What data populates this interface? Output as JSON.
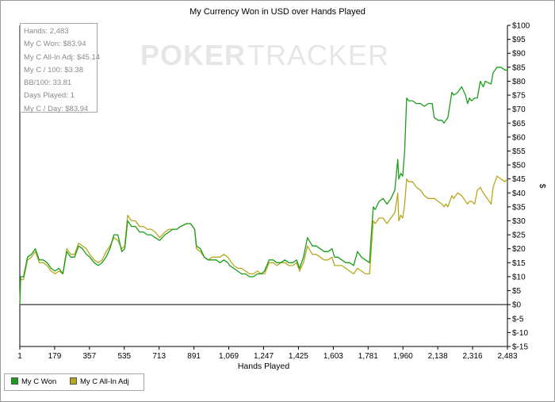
{
  "colors": {
    "won": "#1a9e1a",
    "allin": "#b5a81e",
    "zero_line": "#000000",
    "watermark": "#e6e6e6"
  },
  "watermark": {
    "left": "POKER",
    "right": "TRACKER"
  },
  "stats": [
    "Hands: 2,483",
    "My C Won: $83.94",
    "My C All-In Adj: $45.14",
    "My C / 100: $3.38",
    "BB/100: 33.81",
    "Days Played: 1",
    "My C / Day: $83.94"
  ],
  "legend": [
    {
      "label": "My C Won",
      "color": "#1a9e1a"
    },
    {
      "label": "My C All-In Adj",
      "color": "#b5a81e"
    }
  ],
  "chart_data": {
    "type": "line",
    "title": "My Currency Won in USD over Hands Played",
    "xlabel": "Hands Played",
    "ylabel": "$",
    "xlim": [
      1,
      2483
    ],
    "ylim": [
      -15,
      100
    ],
    "x_ticks": [
      "1",
      "179",
      "357",
      "535",
      "713",
      "891",
      "1,069",
      "1,247",
      "1,425",
      "1,603",
      "1,781",
      "1,960",
      "2,138",
      "2,316",
      "2,483"
    ],
    "y_ticks": [
      -15,
      -10,
      -5,
      0,
      5,
      10,
      15,
      20,
      25,
      30,
      35,
      40,
      45,
      50,
      55,
      60,
      65,
      70,
      75,
      80,
      85,
      90,
      95,
      100
    ],
    "y_tick_labels": [
      "$-15",
      "$-10",
      "$-5",
      "$0",
      "$5",
      "$10",
      "$15",
      "$20",
      "$25",
      "$30",
      "$35",
      "$40",
      "$45",
      "$50",
      "$55",
      "$60",
      "$65",
      "$70",
      "$75",
      "$80",
      "$85",
      "$90",
      "$95",
      "$100"
    ],
    "legend_position": "bottom-left",
    "grid": false,
    "series": [
      {
        "name": "My C Won",
        "color": "#1a9e1a",
        "points": [
          [
            1,
            0
          ],
          [
            5,
            10
          ],
          [
            20,
            10
          ],
          [
            40,
            17
          ],
          [
            60,
            18
          ],
          [
            80,
            20
          ],
          [
            100,
            16
          ],
          [
            120,
            16
          ],
          [
            140,
            15
          ],
          [
            160,
            13
          ],
          [
            180,
            12
          ],
          [
            200,
            13
          ],
          [
            220,
            11
          ],
          [
            240,
            19
          ],
          [
            260,
            17
          ],
          [
            280,
            17
          ],
          [
            300,
            21
          ],
          [
            320,
            20
          ],
          [
            340,
            18
          ],
          [
            357,
            17
          ],
          [
            380,
            15
          ],
          [
            400,
            14
          ],
          [
            420,
            15
          ],
          [
            440,
            17
          ],
          [
            460,
            20
          ],
          [
            480,
            25
          ],
          [
            500,
            25
          ],
          [
            520,
            19
          ],
          [
            535,
            20
          ],
          [
            550,
            30
          ],
          [
            570,
            28
          ],
          [
            590,
            28
          ],
          [
            610,
            26
          ],
          [
            630,
            26
          ],
          [
            650,
            25
          ],
          [
            670,
            25
          ],
          [
            690,
            24
          ],
          [
            713,
            23
          ],
          [
            740,
            25
          ],
          [
            760,
            26
          ],
          [
            780,
            27
          ],
          [
            800,
            27
          ],
          [
            820,
            28
          ],
          [
            850,
            29
          ],
          [
            870,
            29
          ],
          [
            891,
            27
          ],
          [
            900,
            21
          ],
          [
            920,
            20
          ],
          [
            940,
            17
          ],
          [
            960,
            16
          ],
          [
            980,
            16
          ],
          [
            1000,
            16
          ],
          [
            1020,
            15
          ],
          [
            1040,
            16
          ],
          [
            1060,
            15
          ],
          [
            1069,
            14
          ],
          [
            1090,
            13
          ],
          [
            1110,
            12
          ],
          [
            1130,
            11
          ],
          [
            1150,
            11
          ],
          [
            1170,
            10
          ],
          [
            1190,
            10
          ],
          [
            1210,
            11
          ],
          [
            1230,
            11
          ],
          [
            1247,
            12
          ],
          [
            1270,
            16
          ],
          [
            1290,
            16
          ],
          [
            1310,
            15
          ],
          [
            1330,
            15
          ],
          [
            1350,
            16
          ],
          [
            1370,
            15
          ],
          [
            1390,
            15
          ],
          [
            1410,
            16
          ],
          [
            1425,
            13
          ],
          [
            1445,
            17
          ],
          [
            1465,
            24
          ],
          [
            1490,
            21
          ],
          [
            1510,
            21
          ],
          [
            1530,
            20
          ],
          [
            1550,
            19
          ],
          [
            1570,
            19
          ],
          [
            1590,
            20
          ],
          [
            1603,
            17
          ],
          [
            1620,
            17
          ],
          [
            1640,
            16
          ],
          [
            1660,
            15
          ],
          [
            1680,
            15
          ],
          [
            1700,
            14
          ],
          [
            1720,
            19
          ],
          [
            1740,
            17
          ],
          [
            1760,
            16
          ],
          [
            1781,
            15
          ],
          [
            1790,
            25
          ],
          [
            1800,
            35
          ],
          [
            1810,
            34
          ],
          [
            1830,
            37
          ],
          [
            1850,
            38
          ],
          [
            1870,
            36
          ],
          [
            1890,
            38
          ],
          [
            1910,
            41
          ],
          [
            1925,
            52
          ],
          [
            1930,
            45
          ],
          [
            1940,
            47
          ],
          [
            1950,
            46
          ],
          [
            1960,
            55
          ],
          [
            1970,
            74
          ],
          [
            1980,
            73
          ],
          [
            2000,
            73
          ],
          [
            2020,
            72
          ],
          [
            2040,
            72
          ],
          [
            2060,
            71
          ],
          [
            2080,
            72
          ],
          [
            2100,
            72
          ],
          [
            2110,
            67
          ],
          [
            2130,
            66
          ],
          [
            2150,
            66
          ],
          [
            2160,
            65
          ],
          [
            2170,
            66
          ],
          [
            2180,
            67
          ],
          [
            2200,
            76
          ],
          [
            2210,
            75
          ],
          [
            2230,
            76
          ],
          [
            2250,
            78
          ],
          [
            2270,
            75
          ],
          [
            2280,
            72
          ],
          [
            2290,
            74
          ],
          [
            2300,
            73
          ],
          [
            2316,
            74
          ],
          [
            2330,
            74
          ],
          [
            2345,
            80
          ],
          [
            2360,
            78
          ],
          [
            2370,
            80
          ],
          [
            2400,
            79
          ],
          [
            2410,
            83
          ],
          [
            2430,
            85
          ],
          [
            2450,
            85
          ],
          [
            2470,
            84
          ],
          [
            2483,
            84
          ]
        ]
      },
      {
        "name": "My C All-In Adj",
        "color": "#b5a81e",
        "points": [
          [
            1,
            0
          ],
          [
            5,
            9
          ],
          [
            20,
            9
          ],
          [
            40,
            16
          ],
          [
            60,
            17
          ],
          [
            80,
            19
          ],
          [
            100,
            15
          ],
          [
            120,
            15
          ],
          [
            140,
            14
          ],
          [
            160,
            12
          ],
          [
            180,
            11
          ],
          [
            200,
            12
          ],
          [
            220,
            11
          ],
          [
            240,
            20
          ],
          [
            260,
            18
          ],
          [
            280,
            18
          ],
          [
            300,
            22
          ],
          [
            320,
            21
          ],
          [
            340,
            20
          ],
          [
            357,
            18
          ],
          [
            380,
            16
          ],
          [
            400,
            15
          ],
          [
            420,
            16
          ],
          [
            440,
            19
          ],
          [
            460,
            21
          ],
          [
            480,
            24
          ],
          [
            500,
            23
          ],
          [
            520,
            20
          ],
          [
            535,
            21
          ],
          [
            550,
            32
          ],
          [
            570,
            30
          ],
          [
            590,
            30
          ],
          [
            610,
            28
          ],
          [
            630,
            28
          ],
          [
            650,
            27
          ],
          [
            670,
            27
          ],
          [
            690,
            26
          ],
          [
            713,
            24
          ],
          [
            740,
            26
          ],
          [
            760,
            27
          ],
          [
            780,
            27
          ],
          [
            800,
            27
          ],
          [
            820,
            28
          ],
          [
            850,
            29
          ],
          [
            870,
            29
          ],
          [
            891,
            27
          ],
          [
            900,
            20
          ],
          [
            920,
            19
          ],
          [
            940,
            17
          ],
          [
            960,
            16
          ],
          [
            980,
            17
          ],
          [
            1000,
            17
          ],
          [
            1020,
            17
          ],
          [
            1040,
            18
          ],
          [
            1060,
            17
          ],
          [
            1069,
            16
          ],
          [
            1090,
            14
          ],
          [
            1110,
            13
          ],
          [
            1130,
            13
          ],
          [
            1150,
            12
          ],
          [
            1170,
            11
          ],
          [
            1190,
            11
          ],
          [
            1210,
            12
          ],
          [
            1230,
            11
          ],
          [
            1247,
            11
          ],
          [
            1270,
            15
          ],
          [
            1290,
            15
          ],
          [
            1310,
            14
          ],
          [
            1330,
            15
          ],
          [
            1350,
            15
          ],
          [
            1370,
            14
          ],
          [
            1390,
            14
          ],
          [
            1410,
            15
          ],
          [
            1425,
            12
          ],
          [
            1445,
            15
          ],
          [
            1465,
            21
          ],
          [
            1490,
            18
          ],
          [
            1510,
            18
          ],
          [
            1530,
            17
          ],
          [
            1550,
            16
          ],
          [
            1570,
            16
          ],
          [
            1590,
            17
          ],
          [
            1603,
            14
          ],
          [
            1620,
            14
          ],
          [
            1640,
            14
          ],
          [
            1660,
            13
          ],
          [
            1680,
            12
          ],
          [
            1700,
            11
          ],
          [
            1720,
            13
          ],
          [
            1740,
            12
          ],
          [
            1760,
            11
          ],
          [
            1781,
            11
          ],
          [
            1790,
            20
          ],
          [
            1800,
            30
          ],
          [
            1810,
            29
          ],
          [
            1830,
            31
          ],
          [
            1850,
            31
          ],
          [
            1870,
            29
          ],
          [
            1890,
            31
          ],
          [
            1910,
            33
          ],
          [
            1925,
            40
          ],
          [
            1930,
            30
          ],
          [
            1940,
            32
          ],
          [
            1950,
            31
          ],
          [
            1960,
            36
          ],
          [
            1970,
            45
          ],
          [
            1980,
            44
          ],
          [
            2000,
            44
          ],
          [
            2020,
            42
          ],
          [
            2040,
            41
          ],
          [
            2060,
            39
          ],
          [
            2080,
            38
          ],
          [
            2100,
            38
          ],
          [
            2110,
            38
          ],
          [
            2130,
            37
          ],
          [
            2150,
            36
          ],
          [
            2160,
            35
          ],
          [
            2170,
            36
          ],
          [
            2180,
            35
          ],
          [
            2200,
            39
          ],
          [
            2210,
            38
          ],
          [
            2230,
            40
          ],
          [
            2250,
            39
          ],
          [
            2270,
            37
          ],
          [
            2280,
            36
          ],
          [
            2290,
            37
          ],
          [
            2300,
            37
          ],
          [
            2316,
            36
          ],
          [
            2330,
            41
          ],
          [
            2345,
            42
          ],
          [
            2360,
            40
          ],
          [
            2370,
            39
          ],
          [
            2400,
            36
          ],
          [
            2410,
            42
          ],
          [
            2430,
            46
          ],
          [
            2450,
            45
          ],
          [
            2470,
            44
          ],
          [
            2483,
            45
          ]
        ]
      }
    ]
  }
}
